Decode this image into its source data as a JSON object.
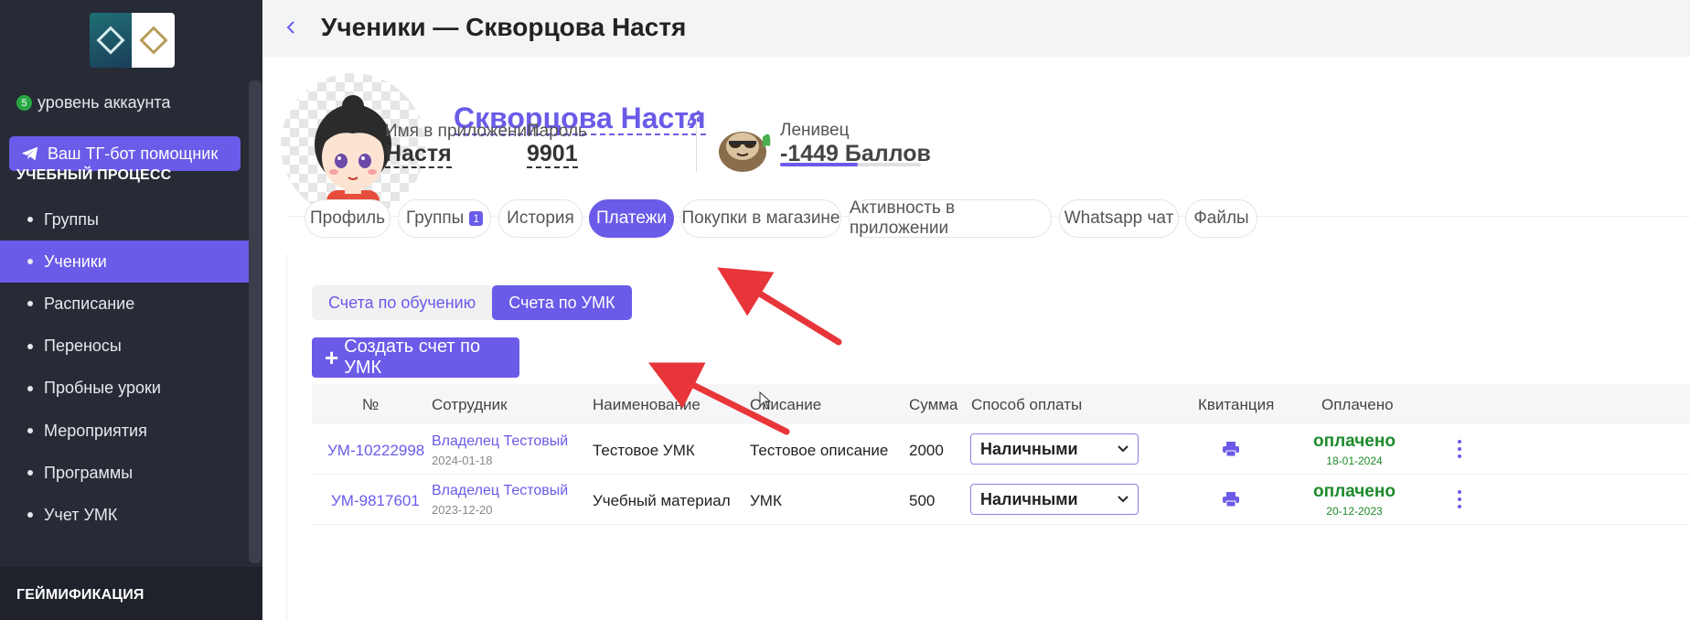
{
  "sidebar": {
    "level_count": "5",
    "level_label": "уровень аккаунта",
    "tg_button": "Ваш ТГ-бот помощник",
    "section1": "УЧЕБНЫЙ ПРОЦЕСС",
    "items": [
      {
        "label": "Группы"
      },
      {
        "label": "Ученики"
      },
      {
        "label": "Расписание"
      },
      {
        "label": "Переносы"
      },
      {
        "label": "Пробные уроки"
      },
      {
        "label": "Мероприятия"
      },
      {
        "label": "Программы"
      },
      {
        "label": "Учет УМК"
      }
    ],
    "active_item": "Ученики",
    "section2": "ГЕЙМИФИКАЦИЯ"
  },
  "header": {
    "title": "Ученики — Скворцова Настя"
  },
  "profile": {
    "name": "Скворцова Настя",
    "app_name_label": "Имя в приложении",
    "app_name_value": "Настя ",
    "password_label": "Пароль",
    "password_value": "9901",
    "level_name": "Ленивец",
    "points": "-1449 Баллов"
  },
  "tabs": [
    {
      "label": "Профиль"
    },
    {
      "label": "Группы",
      "count": "1"
    },
    {
      "label": "История"
    },
    {
      "label": "Платежи"
    },
    {
      "label": "Покупки в магазине"
    },
    {
      "label": "Активность в приложении"
    },
    {
      "label": "Whatsapp чат"
    },
    {
      "label": "Файлы"
    }
  ],
  "active_tab": "Платежи",
  "subtabs": [
    {
      "label": "Счета по обучению"
    },
    {
      "label": "Счета по УМК"
    }
  ],
  "active_subtab": "Счета по УМК",
  "create_button": "Создать счет по УМК",
  "table": {
    "columns": [
      "№",
      "Сотрудник",
      "Наименование",
      "Описание",
      "Сумма",
      "Способ оплаты",
      "Квитанция",
      "Оплачено"
    ],
    "rows": [
      {
        "number": "УМ-10222998",
        "employee": "Владелец Тестовый",
        "employee_date": "2024-01-18",
        "name": "Тестовое УМК",
        "description": "Тестовое описание",
        "sum": "2000",
        "payment_method": "Наличными",
        "status": "оплачено",
        "paid_date": "18-01-2024"
      },
      {
        "number": "УМ-9817601",
        "employee": "Владелец Тестовый",
        "employee_date": "2023-12-20",
        "name": "Учебный материал",
        "description": "УМК",
        "sum": "500",
        "payment_method": "Наличными",
        "status": "оплачено",
        "paid_date": "20-12-2023"
      }
    ]
  },
  "colors": {
    "accent": "#6a5be8",
    "sidebar_bg": "#272b36",
    "paid_green": "#1e8a2c",
    "arrow_red": "#e8353a"
  }
}
